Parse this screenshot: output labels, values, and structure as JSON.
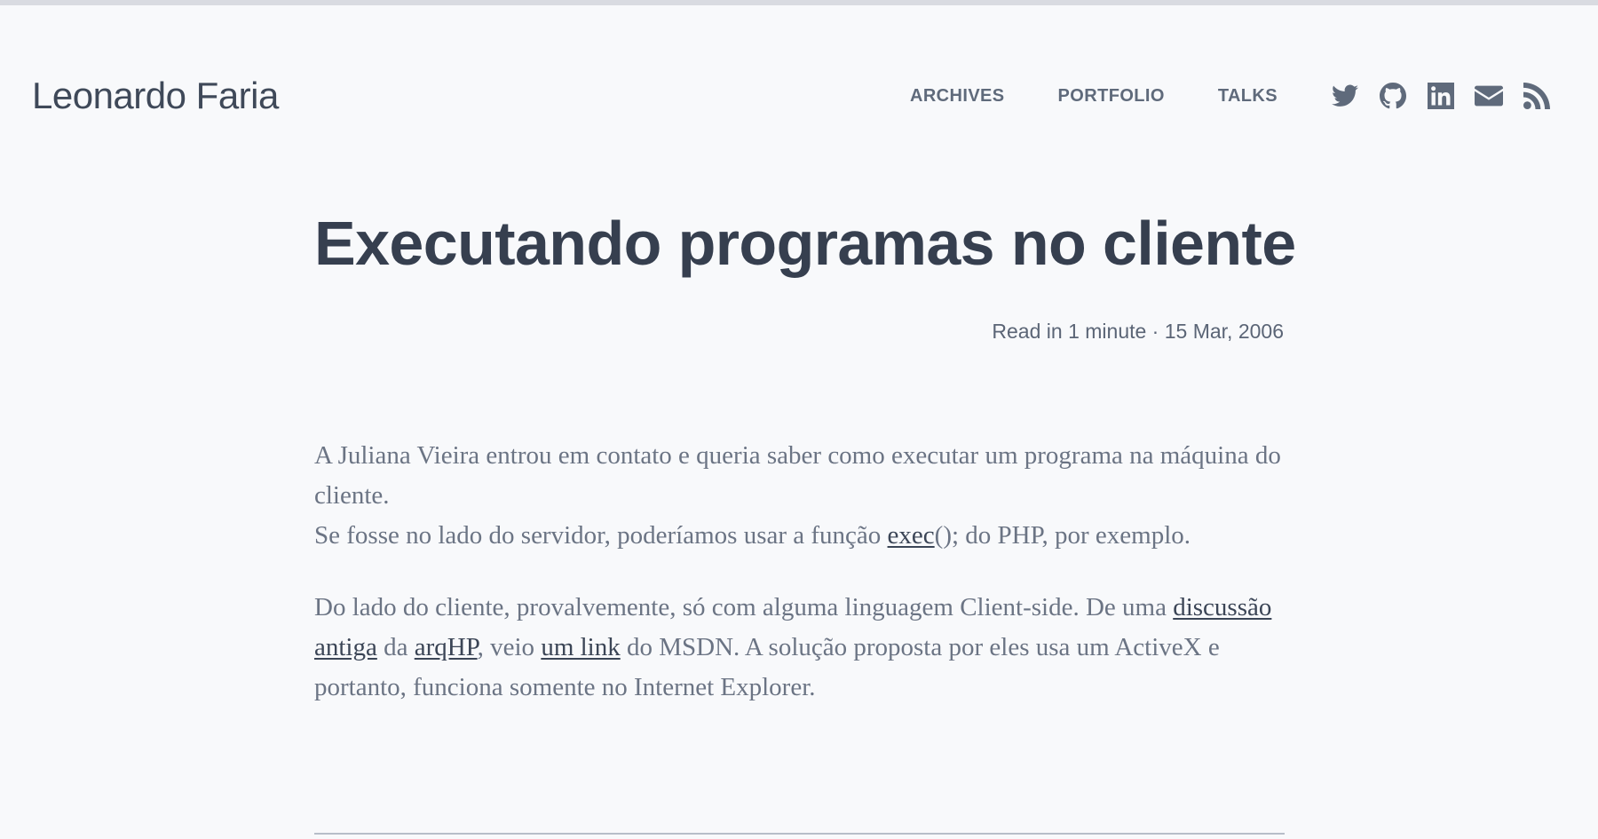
{
  "site": {
    "title": "Leonardo Faria"
  },
  "nav": {
    "links": [
      {
        "label": "ARCHIVES"
      },
      {
        "label": "PORTFOLIO"
      },
      {
        "label": "TALKS"
      }
    ],
    "social": [
      "twitter-icon",
      "github-icon",
      "linkedin-icon",
      "email-icon",
      "rss-icon"
    ]
  },
  "post": {
    "title": "Executando programas no cliente",
    "meta": "Read in 1 minute · 15 Mar, 2006",
    "p1": {
      "text1": "A Juliana Vieira entrou em contato e queria saber como executar um programa na máquina do cliente.",
      "text2": "Se fosse no lado do servidor, poderíamos usar a função ",
      "link_exec": "exec",
      "text3": "(); do PHP, por exemplo."
    },
    "p2": {
      "text1": "Do lado do cliente, provalvemente, só com alguma linguagem Client-side. De uma ",
      "link_discussao": "discussão antiga",
      "text2": " da ",
      "link_arqhp": "arqHP",
      "text3": ", veio ",
      "link_umlink": "um link",
      "text4": " do MSDN. A solução proposta por eles usa um ActiveX e portanto, funciona somente no Internet Explorer."
    }
  },
  "colors": {
    "background": "#f8f9fb",
    "heading": "#363f4f",
    "nav": "#5f6a7b",
    "body_text": "#6b7484",
    "link": "#3b4556"
  }
}
